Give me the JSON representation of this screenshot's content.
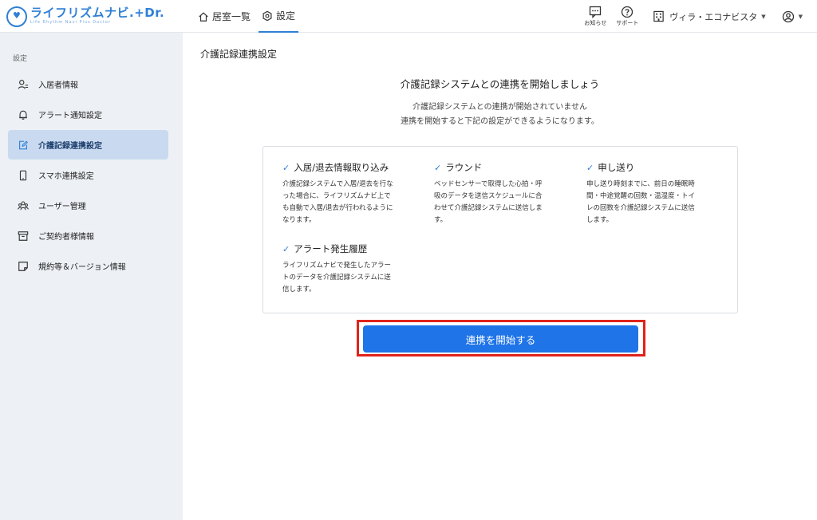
{
  "app": {
    "logo_text": "ライフリズムナビ.+Dr.",
    "logo_sub": "Life Rhythm Navi Plus Doctor"
  },
  "header": {
    "nav": [
      {
        "label": "居室一覧",
        "icon": "home-icon"
      },
      {
        "label": "設定",
        "icon": "gear-icon"
      }
    ],
    "notifications_label": "お知らせ",
    "support_label": "サポート",
    "facility_name": "ヴィラ・エコナビスタ"
  },
  "sidebar": {
    "heading": "設定",
    "items": [
      {
        "label": "入居者情報",
        "icon": "resident-icon"
      },
      {
        "label": "アラート通知設定",
        "icon": "bell-icon"
      },
      {
        "label": "介護記録連携設定",
        "icon": "edit-document-icon"
      },
      {
        "label": "スマホ連携設定",
        "icon": "smartphone-icon"
      },
      {
        "label": "ユーザー管理",
        "icon": "users-icon"
      },
      {
        "label": "ご契約者様情報",
        "icon": "archive-icon"
      },
      {
        "label": "規約等＆バージョン情報",
        "icon": "note-icon"
      }
    ]
  },
  "main": {
    "page_title": "介護記録連携設定",
    "lead": "介護記録システムとの連携を開始しましょう",
    "desc_line1": "介護記録システムとの連携が開始されていません",
    "desc_line2": "連携を開始すると下記の設定ができるようになります。",
    "features": [
      {
        "title": "入居/退去情報取り込み",
        "body": [
          "介護記録システムで入居/退去を行な",
          "った場合に、ライフリズムナビ上で",
          "も自動で入居/退去が行われるように",
          "なります。"
        ]
      },
      {
        "title": "ラウンド",
        "body": [
          "ベッドセンサーで取得した心拍・呼",
          "吸のデータを送信スケジュールに合",
          "わせて介護記録システムに送信しま",
          "す。"
        ]
      },
      {
        "title": "申し送り",
        "body": [
          "申し送り時刻までに、前日の睡眠時",
          "間・中途覚醒の回数・温湿度・トイ",
          "レの回数を介護記録システムに送信",
          "します。"
        ]
      },
      {
        "title": "アラート発生履歴",
        "body": [
          "ライフリズムナビで発生したアラー",
          "トのデータを介護記録システムに送",
          "信します。"
        ]
      }
    ],
    "start_button": "連携を開始する"
  },
  "colors": {
    "accent": "#1f74e8",
    "highlight": "#e0231b",
    "sidebar_bg": "#edf0f4",
    "sidebar_active": "#c9daf0"
  }
}
